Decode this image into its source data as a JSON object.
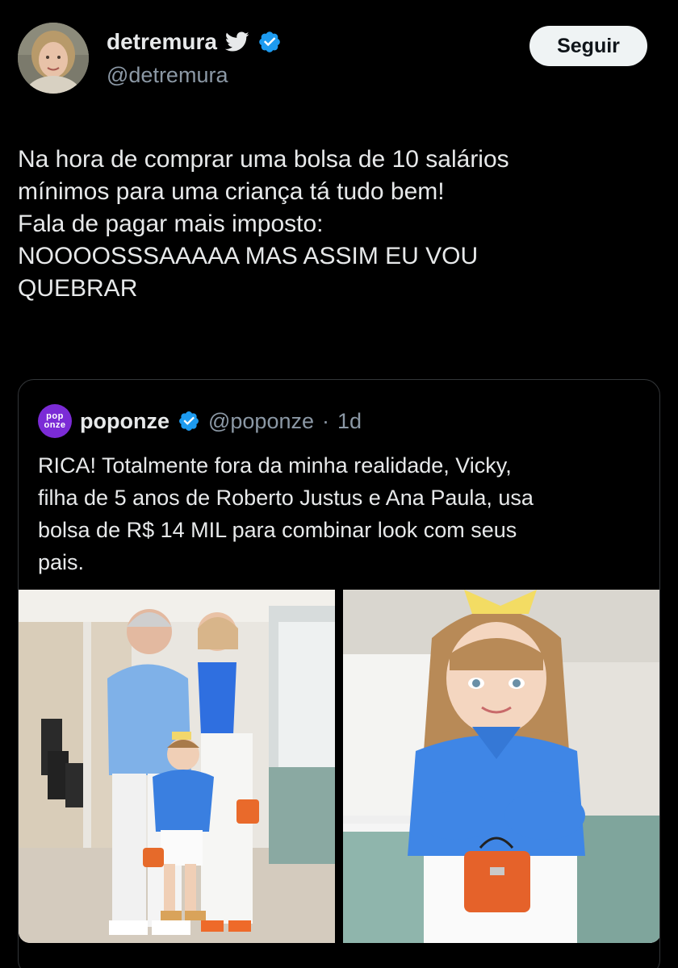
{
  "user": {
    "display_name": "detremura",
    "handle": "@detremura",
    "follow_label": "Seguir"
  },
  "tweet": {
    "lines": [
      "Na hora de comprar uma bolsa de 10 salários",
      "mínimos para uma criança tá tudo bem!",
      "Fala de pagar mais imposto:",
      "NOOOOSSSAAAAA MAS ASSIM EU VOU",
      "QUEBRAR"
    ]
  },
  "quote": {
    "logo_top": "pop",
    "logo_bottom": "onze",
    "display_name": "poponze",
    "handle": "@poponze",
    "separator": "·",
    "time": "1d",
    "lines": [
      "RICA! Totalmente fora da minha realidade, Vicky,",
      "filha de 5 anos de Roberto Justus e Ana Paula, usa",
      "bolsa de R$ 14 MIL para combinar look com seus",
      "pais."
    ]
  },
  "icons": {
    "twitter": "twitter-bird-icon",
    "verified": "verified-badge-icon"
  },
  "colors": {
    "background": "#000000",
    "text": "#e7e9ea",
    "secondary_text": "#8b98a5",
    "twitter_blue": "#1d9bf0",
    "follow_button": "#eff3f4",
    "poponze_purple": "#7b2bd6"
  }
}
